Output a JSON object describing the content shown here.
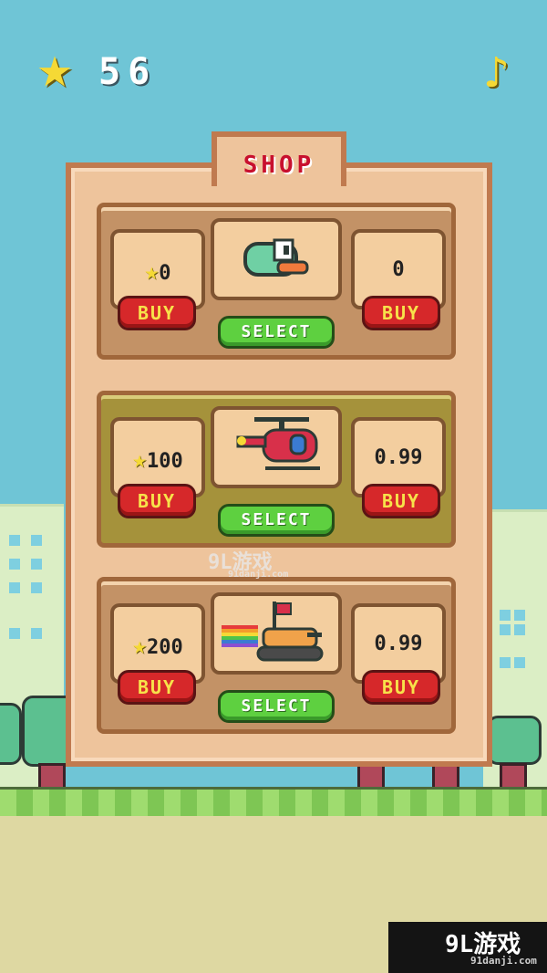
{
  "hud": {
    "score": "56"
  },
  "shop": {
    "title": "SHOP",
    "items": [
      {
        "star_price": "0",
        "real_price": "0",
        "buy_label": "BUY",
        "select_label": "SELECT"
      },
      {
        "star_price": "100",
        "real_price": "0.99",
        "buy_label": "BUY",
        "select_label": "SELECT"
      },
      {
        "star_price": "200",
        "real_price": "0.99",
        "buy_label": "BUY",
        "select_label": "SELECT"
      }
    ]
  },
  "watermark": {
    "logo": "9L游戏",
    "url": "91danji.com"
  },
  "colors": {
    "sky": "#6fc5d6",
    "panel": "#eec49c",
    "buy": "#d6282a",
    "select": "#5ed040",
    "star": "#f5d935"
  }
}
